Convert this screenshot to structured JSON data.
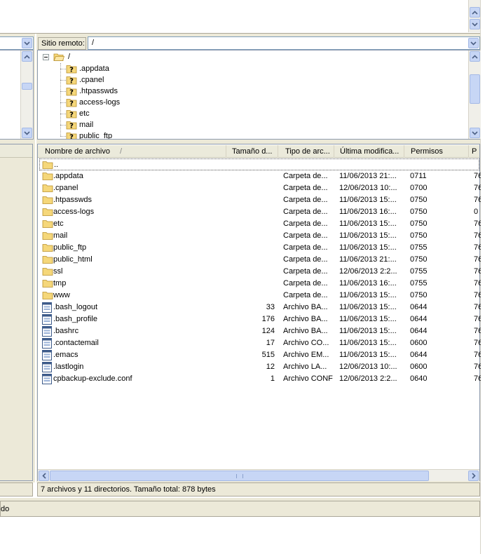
{
  "top_panel": {},
  "remote": {
    "site_label": "Sitio remoto:",
    "path_value": "/"
  },
  "tree": {
    "root": "/",
    "items": [
      ".appdata",
      ".cpanel",
      ".htpasswds",
      "access-logs",
      "etc",
      "mail",
      "public_ftp"
    ]
  },
  "list": {
    "columns": [
      "Nombre de archivo",
      "Tamaño d...",
      "Tipo de arc...",
      "Última modifica...",
      "Permisos",
      "P"
    ],
    "sort_indicator": "/",
    "parent_row": "..",
    "rows": [
      {
        "name": ".appdata",
        "size": "",
        "type": "Carpeta de...",
        "modified": "11/06/2013 21:...",
        "perms": "0711",
        "owner": "76",
        "icon": "folder"
      },
      {
        "name": ".cpanel",
        "size": "",
        "type": "Carpeta de...",
        "modified": "12/06/2013 10:...",
        "perms": "0700",
        "owner": "76",
        "icon": "folder"
      },
      {
        "name": ".htpasswds",
        "size": "",
        "type": "Carpeta de...",
        "modified": "11/06/2013 15:...",
        "perms": "0750",
        "owner": "76",
        "icon": "folder"
      },
      {
        "name": "access-logs",
        "size": "",
        "type": "Carpeta de...",
        "modified": "11/06/2013 16:...",
        "perms": "0750",
        "owner": "0",
        "icon": "folder"
      },
      {
        "name": "etc",
        "size": "",
        "type": "Carpeta de...",
        "modified": "11/06/2013 15:...",
        "perms": "0750",
        "owner": "76",
        "icon": "folder"
      },
      {
        "name": "mail",
        "size": "",
        "type": "Carpeta de...",
        "modified": "11/06/2013 15:...",
        "perms": "0750",
        "owner": "76",
        "icon": "folder"
      },
      {
        "name": "public_ftp",
        "size": "",
        "type": "Carpeta de...",
        "modified": "11/06/2013 15:...",
        "perms": "0755",
        "owner": "76",
        "icon": "folder"
      },
      {
        "name": "public_html",
        "size": "",
        "type": "Carpeta de...",
        "modified": "11/06/2013 21:...",
        "perms": "0750",
        "owner": "76",
        "icon": "folder"
      },
      {
        "name": "ssl",
        "size": "",
        "type": "Carpeta de...",
        "modified": "12/06/2013 2:2...",
        "perms": "0755",
        "owner": "76",
        "icon": "folder"
      },
      {
        "name": "tmp",
        "size": "",
        "type": "Carpeta de...",
        "modified": "11/06/2013 16:...",
        "perms": "0755",
        "owner": "76",
        "icon": "folder"
      },
      {
        "name": "www",
        "size": "",
        "type": "Carpeta de...",
        "modified": "11/06/2013 15:...",
        "perms": "0750",
        "owner": "76",
        "icon": "folder"
      },
      {
        "name": ".bash_logout",
        "size": "33",
        "type": "Archivo BA...",
        "modified": "11/06/2013 15:...",
        "perms": "0644",
        "owner": "76",
        "icon": "file"
      },
      {
        "name": ".bash_profile",
        "size": "176",
        "type": "Archivo BA...",
        "modified": "11/06/2013 15:...",
        "perms": "0644",
        "owner": "76",
        "icon": "file"
      },
      {
        "name": ".bashrc",
        "size": "124",
        "type": "Archivo BA...",
        "modified": "11/06/2013 15:...",
        "perms": "0644",
        "owner": "76",
        "icon": "file"
      },
      {
        "name": ".contactemail",
        "size": "17",
        "type": "Archivo CO...",
        "modified": "11/06/2013 15:...",
        "perms": "0600",
        "owner": "76",
        "icon": "file"
      },
      {
        "name": ".emacs",
        "size": "515",
        "type": "Archivo EM...",
        "modified": "11/06/2013 15:...",
        "perms": "0644",
        "owner": "76",
        "icon": "file"
      },
      {
        "name": ".lastlogin",
        "size": "12",
        "type": "Archivo LA...",
        "modified": "12/06/2013 10:...",
        "perms": "0600",
        "owner": "76",
        "icon": "file"
      },
      {
        "name": "cpbackup-exclude.conf",
        "size": "1",
        "type": "Archivo CONF",
        "modified": "12/06/2013 2:2...",
        "perms": "0640",
        "owner": "76",
        "icon": "file"
      }
    ]
  },
  "status": {
    "remote_summary": "7 archivos y 11 directorios. Tamaño total: 878 bytes",
    "bottom_text": "do"
  },
  "colors": {
    "folder": "#f5d77a",
    "scroll_button": "#c7d6f5",
    "toolbar_bg": "#ece9d8"
  }
}
